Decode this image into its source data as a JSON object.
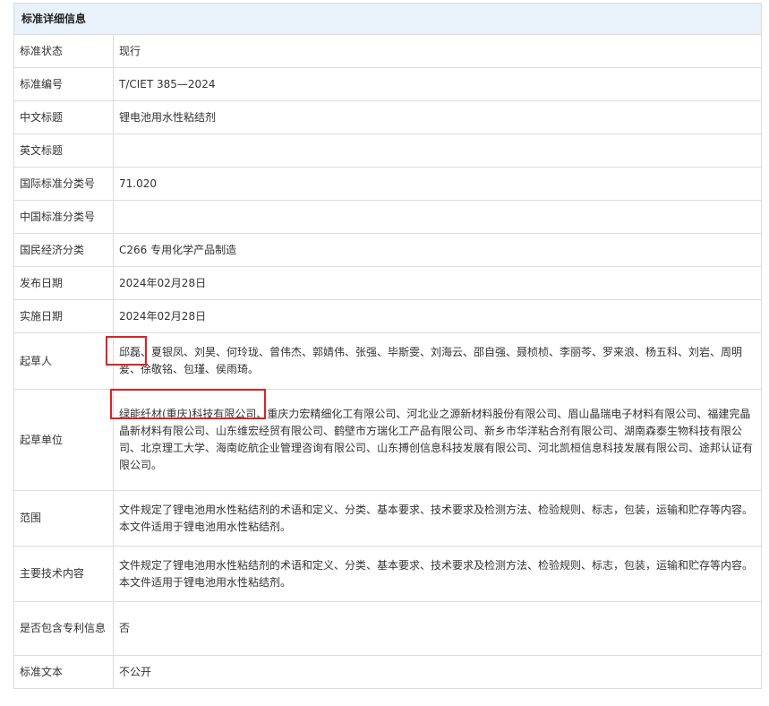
{
  "section_title": "标准详细信息",
  "rows": {
    "status": {
      "label": "标准状态",
      "value": "现行"
    },
    "number": {
      "label": "标准编号",
      "value": "T/CIET 385—2024"
    },
    "cn_title": {
      "label": "中文标题",
      "value": "锂电池用水性粘结剂"
    },
    "en_title": {
      "label": "英文标题",
      "value": ""
    },
    "ics": {
      "label": "国际标准分类号",
      "value": "71.020"
    },
    "ccs": {
      "label": "中国标准分类号",
      "value": ""
    },
    "economy": {
      "label": "国民经济分类",
      "value": "C266 专用化学产品制造"
    },
    "publish_date": {
      "label": "发布日期",
      "value": "2024年02月28日"
    },
    "effective_date": {
      "label": "实施日期",
      "value": "2024年02月28日"
    },
    "drafters": {
      "label": "起草人",
      "value": "邱磊、夏银凤、刘昊、何玲珑、曾伟杰、郭婧伟、张强、毕斯雯、刘海云、邵自强、聂桢桢、李丽芩、罗来浪、杨五科、刘岩、周明爰、徐敬铭、包瑾、侯雨琦。"
    },
    "drafting_units": {
      "label": "起草单位",
      "value": "绿能纤材(重庆)科技有限公司、重庆力宏精细化工有限公司、河北业之源新材料股份有限公司、眉山晶瑞电子材料有限公司、福建完晶晶新材料有限公司、山东维宏经贸有限公司、鹤壁市方瑞化工产品有限公司、新乡市华洋粘合剂有限公司、湖南森泰生物科技有限公司、北京理工大学、海南屹航企业管理咨询有限公司、山东搏创信息科技发展有限公司、河北凯桓信息科技发展有限公司、途邦认证有限公司。"
    },
    "scope": {
      "label": "范围",
      "value": "文件规定了锂电池用水性粘结剂的术语和定义、分类、基本要求、技术要求及检测方法、检验规则、标志，包装，运输和贮存等内容。本文件适用于锂电池用水性粘结剂。"
    },
    "main_content": {
      "label": "主要技术内容",
      "value": "文件规定了锂电池用水性粘结剂的术语和定义、分类、基本要求、技术要求及检测方法、检验规则、标志，包装，运输和贮存等内容。本文件适用于锂电池用水性粘结剂。"
    },
    "patent": {
      "label": "是否包含专利信息",
      "value": "否"
    },
    "text": {
      "label": "标准文本",
      "value": "不公开"
    }
  }
}
